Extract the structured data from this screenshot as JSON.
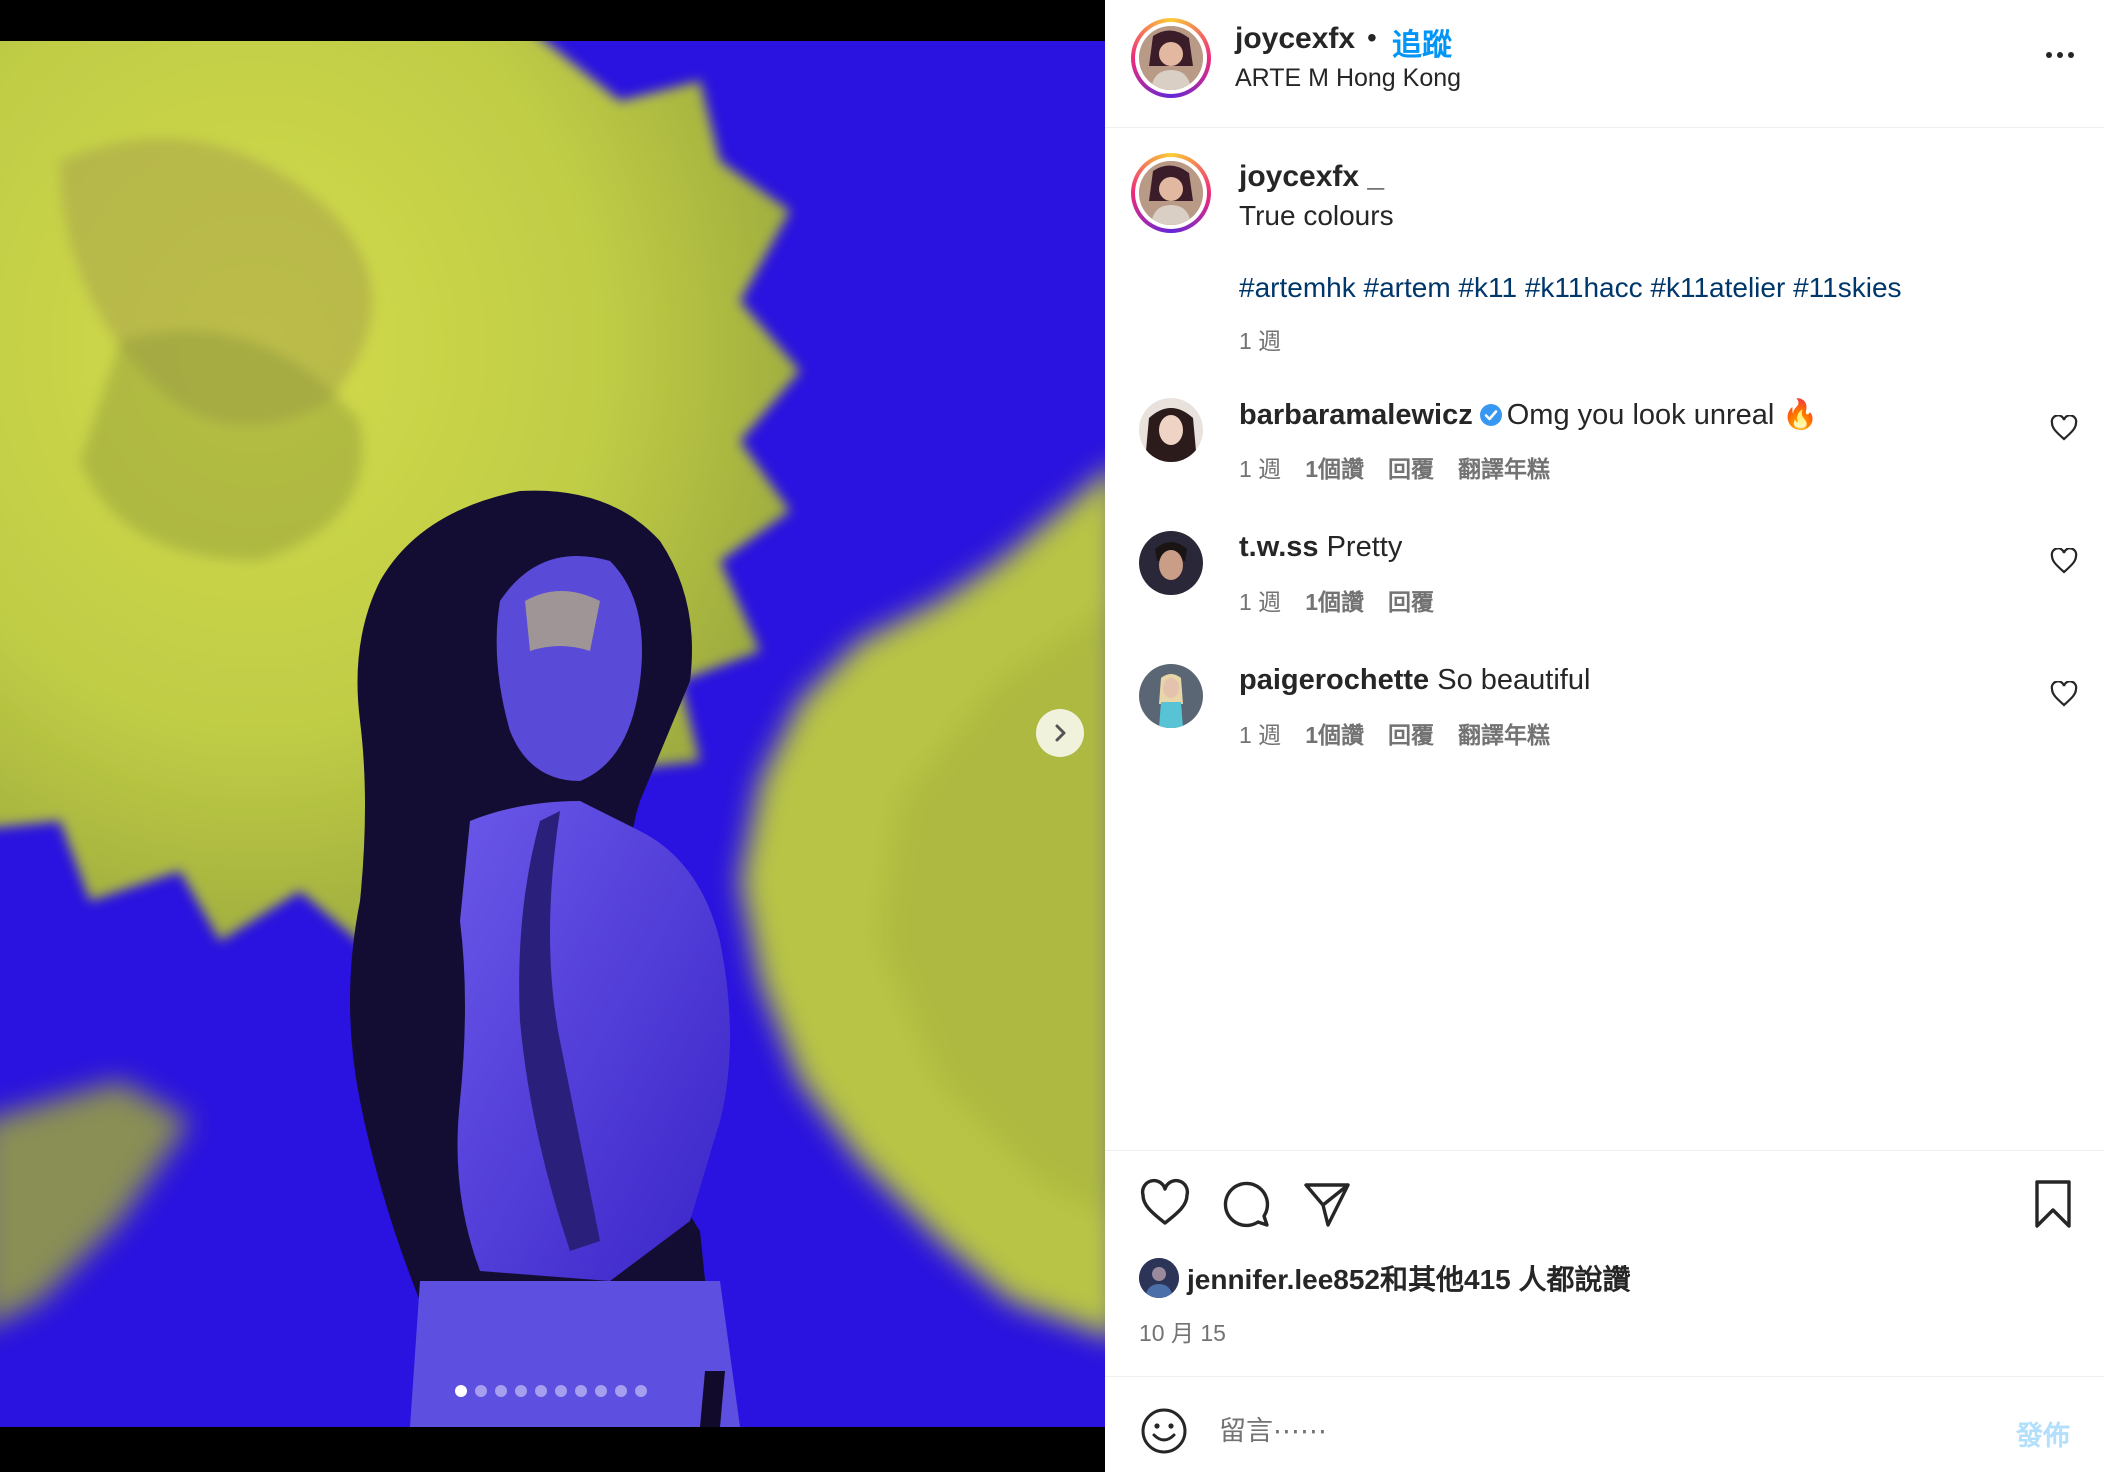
{
  "media": {
    "carousel_count": 10,
    "carousel_active_index": 0,
    "colors": {
      "background_blue": "#2a12e0",
      "flower_yellow": "#c8d646"
    }
  },
  "header": {
    "username": "joycexfx",
    "separator": "•",
    "follow_label": "追蹤",
    "location": "ARTE M Hong Kong"
  },
  "caption": {
    "username": "joycexfx _",
    "text": "True colours",
    "hashtags": "#artemhk #artem #k11 #k11hacc #k11atelier #11skies",
    "time": "1 週"
  },
  "comments": [
    {
      "user": "barbaramalewicz",
      "verified": true,
      "text": "Omg you look unreal 🔥",
      "time": "1 週",
      "likes": "1個讚",
      "reply": "回覆",
      "translate": "翻譯年糕"
    },
    {
      "user": "t.w.ss",
      "verified": false,
      "text": "Pretty",
      "time": "1 週",
      "likes": "1個讚",
      "reply": "回覆"
    },
    {
      "user": "paigerochette",
      "verified": false,
      "text": "So beautiful",
      "time": "1 週",
      "likes": "1個讚",
      "reply": "回覆",
      "translate": "翻譯年糕"
    }
  ],
  "likes_line": "jennifer.lee852和其他415 人都說讚",
  "date": "10 月 15",
  "comment_box": {
    "placeholder": "留言⋯⋯",
    "post_label": "發佈"
  },
  "icons": [
    "like-icon",
    "comment-icon",
    "share-icon",
    "save-icon",
    "emoji-icon",
    "more-icon",
    "chevron-right-icon",
    "heart-icon",
    "verified-icon"
  ],
  "colors": {
    "accent": "#0095f6",
    "text": "#262626",
    "muted": "#737373",
    "hashtag": "#00376b",
    "post_disabled": "#b2dffc"
  }
}
